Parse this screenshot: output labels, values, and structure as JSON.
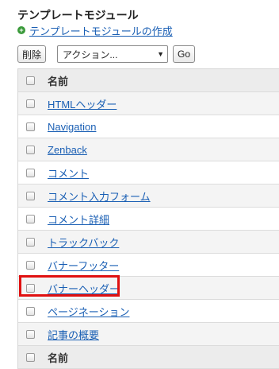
{
  "page": {
    "title": "テンプレートモジュール"
  },
  "create": {
    "label": "テンプレートモジュールの作成",
    "icon": "plus-circle-icon"
  },
  "toolbar": {
    "delete_label": "削除",
    "action_select_value": "アクション...",
    "go_label": "Go"
  },
  "table": {
    "header_label": "名前",
    "footer_label": "名前",
    "rows": [
      {
        "name": "HTMLヘッダー"
      },
      {
        "name": "Navigation"
      },
      {
        "name": "Zenback"
      },
      {
        "name": "コメント"
      },
      {
        "name": "コメント入力フォーム"
      },
      {
        "name": "コメント詳細"
      },
      {
        "name": "トラックバック"
      },
      {
        "name": "バナーフッター"
      },
      {
        "name": "バナーヘッダー"
      },
      {
        "name": "ページネーション"
      },
      {
        "name": "記事の概要"
      }
    ]
  },
  "colors": {
    "link": "#1a5fb4",
    "highlight": "#e01010",
    "plus_icon": "#3a9a3a"
  }
}
